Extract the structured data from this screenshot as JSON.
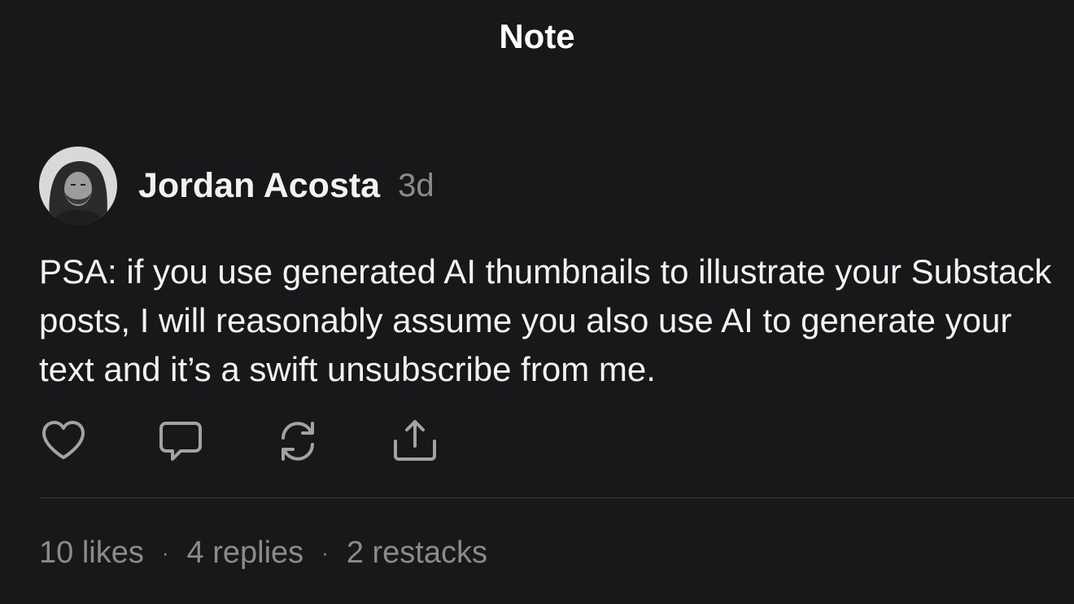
{
  "header": {
    "title": "Note"
  },
  "note": {
    "author": "Jordan Acosta",
    "timestamp": "3d",
    "body": "PSA: if you use generated AI thumbnails to illustrate your Substack posts, I will reasonably assume you also use AI to generate your text and it’s a swift unsubscribe from me."
  },
  "actions": [
    {
      "name": "like",
      "icon": "heart-icon"
    },
    {
      "name": "reply",
      "icon": "comment-icon"
    },
    {
      "name": "restack",
      "icon": "restack-icon"
    },
    {
      "name": "share",
      "icon": "share-icon"
    }
  ],
  "stats": {
    "likes": "10 likes",
    "replies": "4 replies",
    "restacks": "2 restacks",
    "separator": "·"
  },
  "colors": {
    "background": "#18181a",
    "text": "#f2f2f2",
    "muted": "#8b8b8e",
    "icon": "#a3a3a6"
  }
}
